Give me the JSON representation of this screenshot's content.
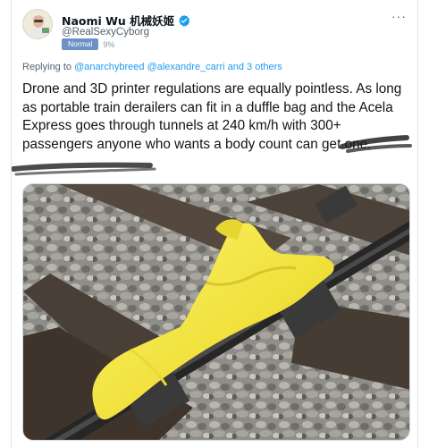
{
  "author": {
    "display_name": "Naomi Wu 机械妖姬",
    "handle": "@RealSexyCyborg",
    "badge_label": "Normal",
    "badge_percent": "9%"
  },
  "icons": {
    "avatar": "avatar-photo",
    "verified": "verified-badge-icon",
    "more": "more-options-icon"
  },
  "colors": {
    "verified": "#1d9bf0",
    "mention": "#1d9bf0",
    "text": "#0f1419",
    "muted": "#536471",
    "derailer": "#f2e53a"
  },
  "more_label": "···",
  "reply": {
    "prefix": "Replying to ",
    "mentions": "@anarchybreed @alexandre_carri",
    "suffix": " and 3 others"
  },
  "tweet": {
    "text": "Drone and 3D printer regulations are equally pointless. As long as portable train derailers can fit in a duffle bag and the Acela Express goes through tunnels at 240 km/h with 300+ passengers anyone who wants a body count can get one."
  },
  "media": {
    "subject": "yellow portable train derailer on a rail"
  }
}
